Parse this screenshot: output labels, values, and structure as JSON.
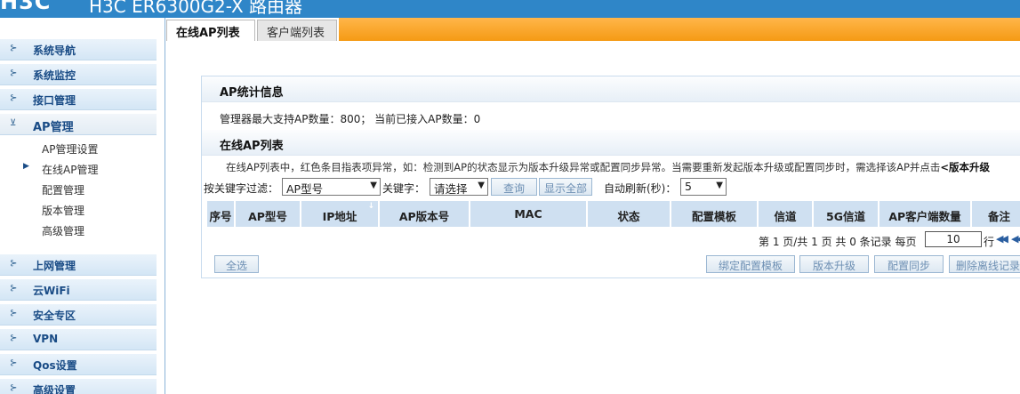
{
  "header": {
    "brand": "H3C",
    "title": "H3C ER6300G2-X 路由器"
  },
  "sidebar": {
    "items": [
      {
        "label": "系统导航",
        "arrow": "⊱"
      },
      {
        "label": "系统监控",
        "arrow": "⊱"
      },
      {
        "label": "接口管理",
        "arrow": "⊱"
      },
      {
        "label": "AP管理",
        "arrow": "⊻"
      },
      {
        "label": "上网管理",
        "arrow": "⊱"
      },
      {
        "label": "云WiFi",
        "arrow": "⊱"
      },
      {
        "label": "安全专区",
        "arrow": "⊱"
      },
      {
        "label": "VPN",
        "arrow": "⊱"
      },
      {
        "label": "Qos设置",
        "arrow": "⊱"
      },
      {
        "label": "高级设置",
        "arrow": "⊱"
      }
    ],
    "sub_items": [
      {
        "label": "AP管理设置"
      },
      {
        "label": "在线AP管理",
        "marker": "▶"
      },
      {
        "label": "配置管理"
      },
      {
        "label": "版本管理"
      },
      {
        "label": "高级管理"
      }
    ]
  },
  "tabs": [
    {
      "label": "在线AP列表"
    },
    {
      "label": "客户端列表"
    }
  ],
  "stats": {
    "title": "AP统计信息",
    "line": "管理器最大支持AP数量：800；  当前已接入AP数量：0"
  },
  "online": {
    "title": "在线AP列表",
    "notice_prefix": "在线AP列表中，红色条目指表项异常，如：检测到AP的状态显示为版本升级异常或配置同步异常。当需要重新发起版本升级或配置同步时，需选择该AP并点击",
    "notice_bold": "<版本升级"
  },
  "filter": {
    "key_label": "按关键字过滤：",
    "key_select": "AP型号",
    "keyword_label": "关键字：",
    "keyword_select": "请选择",
    "query_button": "查询",
    "show_all_button": "显示全部",
    "refresh_label": "自动刷新(秒)：",
    "refresh_select": "5"
  },
  "table": {
    "columns": [
      "序号",
      "AP型号",
      "IP地址",
      "AP版本号",
      "MAC",
      "状态",
      "配置模板",
      "信道",
      "5G信道",
      "AP客户端数量",
      "备注"
    ],
    "sort_icon": "↓"
  },
  "pager": {
    "prefix": "第 1 页/共 1 页 共 0 条记录 每页",
    "per_page": "10",
    "suffix": "行",
    "first_icon": "◀◀",
    "prev_icon": "◀◀"
  },
  "actions": {
    "select_all": "全选",
    "bind_template": "绑定配置模板",
    "upgrade": "版本升级",
    "sync": "配置同步",
    "delete_offline": "删除离线记录"
  }
}
